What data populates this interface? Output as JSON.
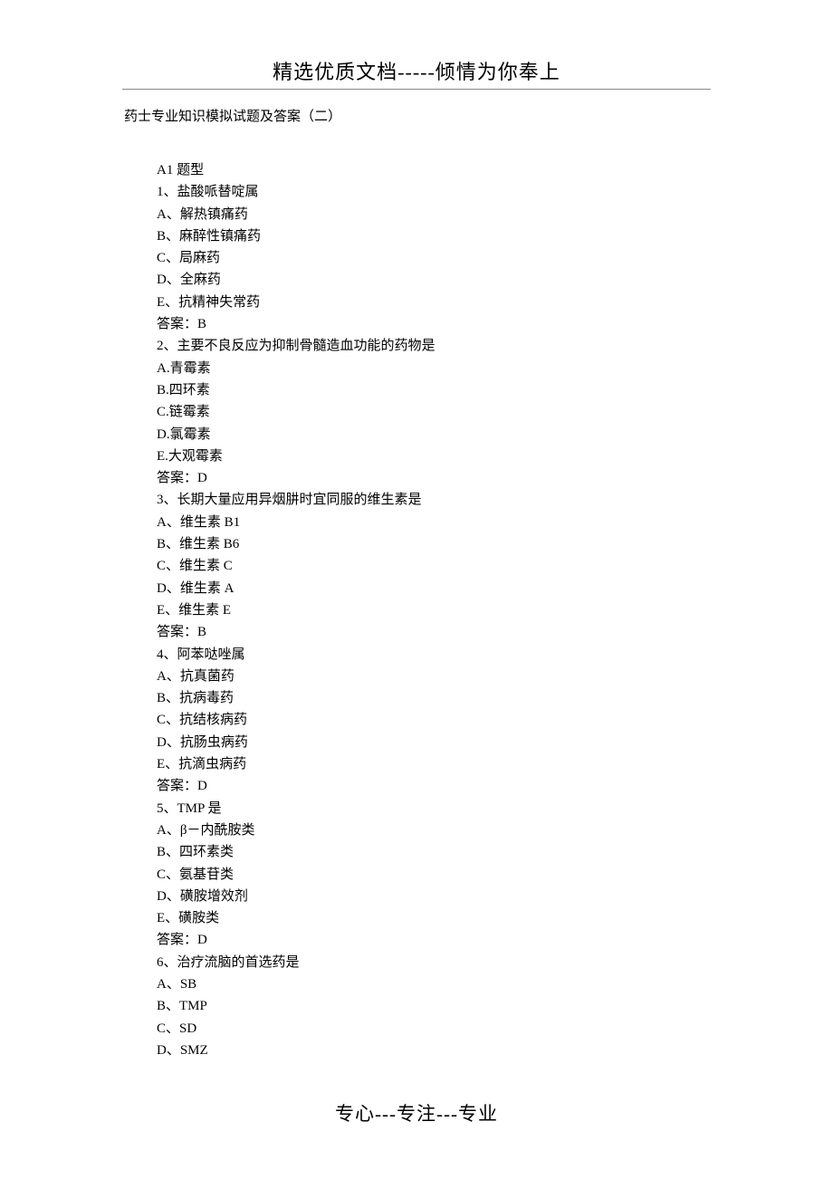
{
  "header": "精选优质文档-----倾情为你奉上",
  "doc_title": "药士专业知识模拟试题及答案（二）",
  "section_label": "A1 题型",
  "questions": [
    {
      "num": "1、",
      "stem": "盐酸哌替啶属",
      "opts": [
        "A、解热镇痛药",
        "B、麻醉性镇痛药",
        "C、局麻药",
        "D、全麻药",
        "E、抗精神失常药"
      ],
      "answer": "答案：B"
    },
    {
      "num": "2、",
      "stem": "主要不良反应为抑制骨髓造血功能的药物是",
      "opts": [
        "A.青霉素",
        "B.四环素",
        "C.链霉素",
        "D.氯霉素",
        "E.大观霉素"
      ],
      "answer": "答案：D"
    },
    {
      "num": "3、",
      "stem": "长期大量应用异烟肼时宜同服的维生素是",
      "opts": [
        "A、维生素 B1",
        "B、维生素 B6",
        "C、维生素 C",
        "D、维生素 A",
        "E、维生素 E"
      ],
      "answer": "答案：B"
    },
    {
      "num": "4、",
      "stem": "阿苯哒唑属",
      "opts": [
        "A、抗真菌药",
        "B、抗病毒药",
        "C、抗结核病药",
        "D、抗肠虫病药",
        "E、抗滴虫病药"
      ],
      "answer": "答案：D"
    },
    {
      "num": "5、",
      "stem": "TMP 是",
      "opts": [
        "A、β－内酰胺类",
        "B、四环素类",
        "C、氨基苷类",
        "D、磺胺增效剂",
        "E、磺胺类"
      ],
      "answer": "答案：D"
    },
    {
      "num": "6、",
      "stem": "治疗流脑的首选药是",
      "opts": [
        "A、SB",
        "B、TMP",
        "C、SD",
        "D、SMZ"
      ],
      "answer": ""
    }
  ],
  "footer": "专心---专注---专业"
}
